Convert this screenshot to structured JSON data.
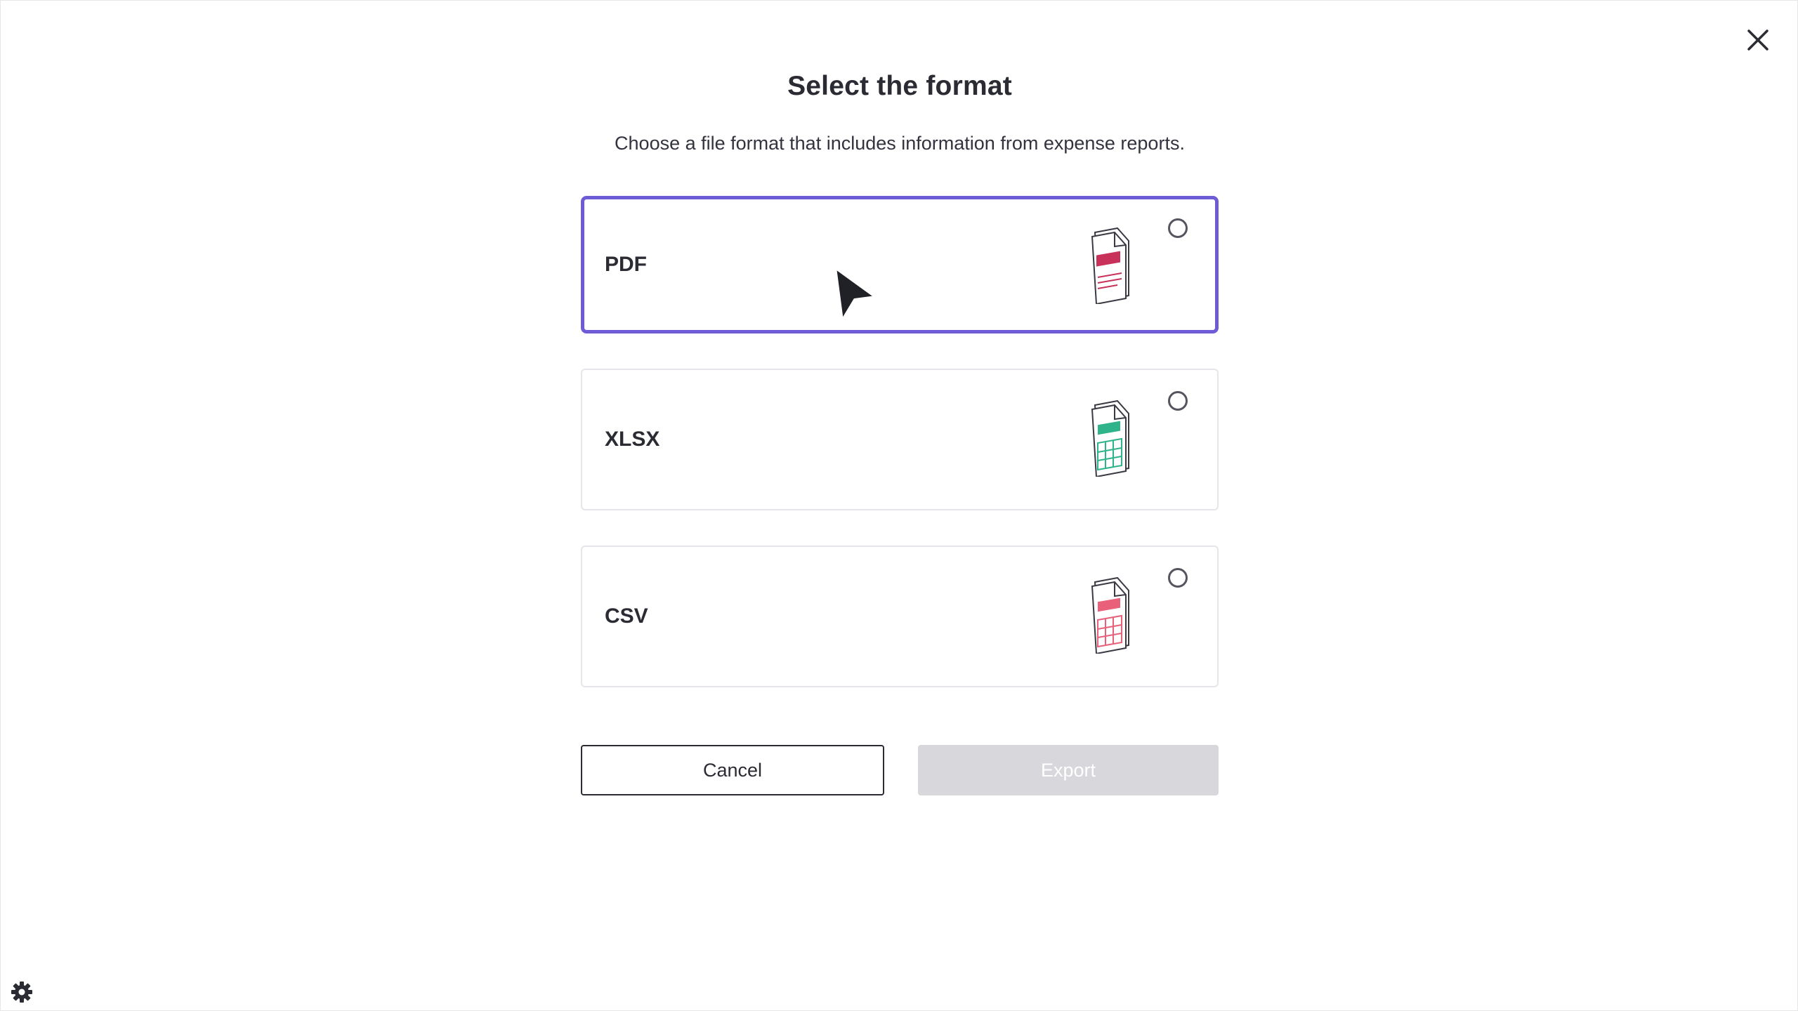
{
  "dialog": {
    "title": "Select the format",
    "subtitle": "Choose a file format that includes information from expense reports."
  },
  "options": [
    {
      "label": "PDF",
      "icon": "pdf-file-icon",
      "icon_color": "#c8325a",
      "selected_highlight": true,
      "checked": false
    },
    {
      "label": "XLSX",
      "icon": "xlsx-file-icon",
      "icon_color": "#2fb38a",
      "selected_highlight": false,
      "checked": false
    },
    {
      "label": "CSV",
      "icon": "csv-file-icon",
      "icon_color": "#e8607a",
      "selected_highlight": false,
      "checked": false
    }
  ],
  "buttons": {
    "cancel_label": "Cancel",
    "export_label": "Export",
    "export_disabled": true
  },
  "icons": {
    "close": "close-icon",
    "settings": "gear-icon"
  },
  "colors": {
    "accent": "#6e5bd6",
    "disabled_button": "#d8d8dc",
    "text": "#2b2b33"
  }
}
